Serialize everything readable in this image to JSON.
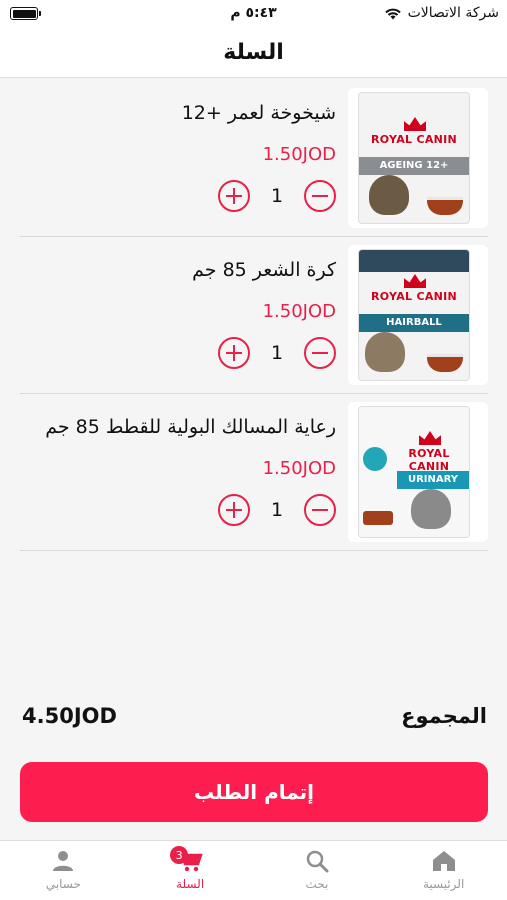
{
  "status_bar": {
    "carrier": "شركة الاتصالات",
    "time": "٥:٤٣ م",
    "wifi_icon": "wifi-icon",
    "battery_icon": "battery-icon"
  },
  "header": {
    "title": "السلة"
  },
  "cart": {
    "items": [
      {
        "name": "شيخوخة لعمر +12",
        "price": "1.50JOD",
        "quantity": "1",
        "image_brand": "ROYAL CANIN",
        "image_band": "AGEING 12+",
        "band_color": "#8a8d91"
      },
      {
        "name": "كرة الشعر 85 جم",
        "price": "1.50JOD",
        "quantity": "1",
        "image_brand": "ROYAL CANIN",
        "image_band": "HAIRBALL",
        "band_color": "#1f6f86"
      },
      {
        "name": "رعاية المسالك البولية للقطط 85 جم",
        "price": "1.50JOD",
        "quantity": "1",
        "image_brand": "ROYAL CANIN",
        "image_band": "URINARY",
        "band_color": "#1898b4"
      }
    ]
  },
  "summary": {
    "total_label": "المجموع",
    "total_value": "4.50JOD"
  },
  "checkout": {
    "label": "إتمام الطلب",
    "color": "#fd1d4e"
  },
  "tabbar": {
    "tabs": [
      {
        "label": "الرئيسية",
        "icon": "home-icon",
        "active": false
      },
      {
        "label": "بحث",
        "icon": "search-icon",
        "active": false
      },
      {
        "label": "السلة",
        "icon": "cart-icon",
        "active": true,
        "badge": "3"
      },
      {
        "label": "حسابي",
        "icon": "user-icon",
        "active": false
      }
    ]
  },
  "colors": {
    "accent": "#e8204a"
  }
}
